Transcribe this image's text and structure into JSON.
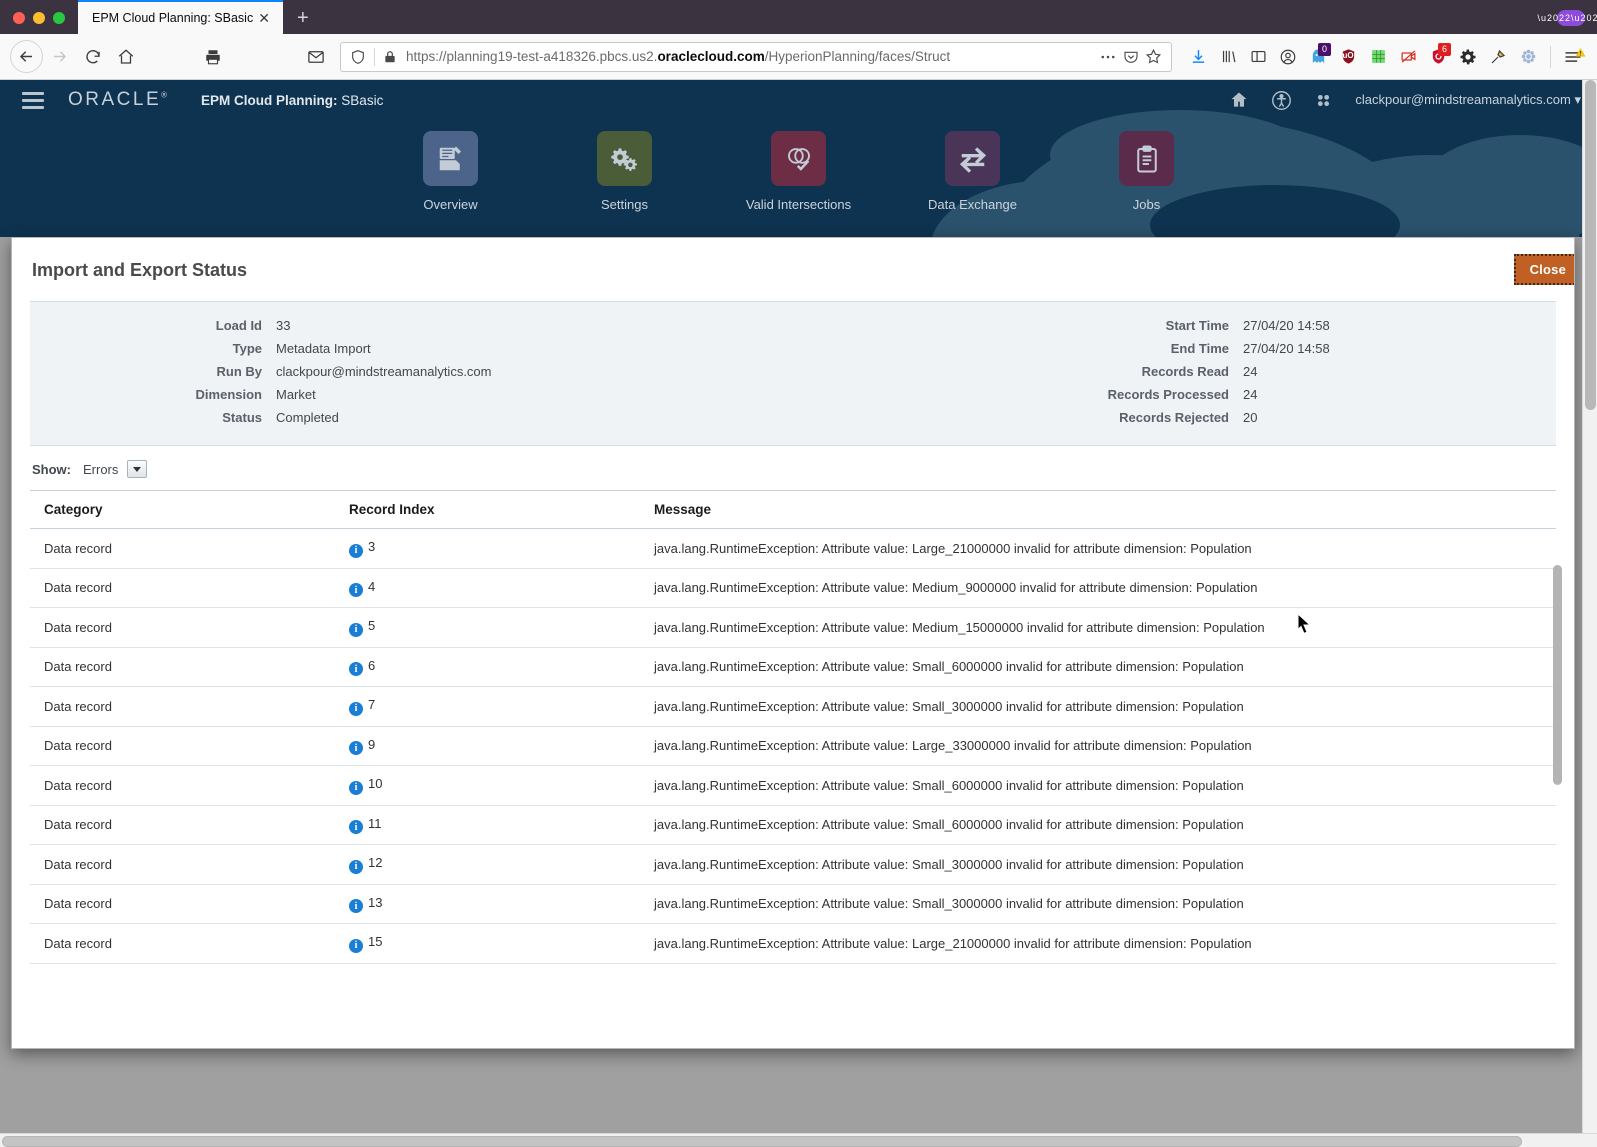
{
  "browser": {
    "tab": {
      "title": "EPM Cloud Planning: SBasic",
      "close_label": "✕"
    },
    "new_tab_label": "+",
    "nav": {
      "back_icon": "back-arrow-icon",
      "forward_icon": "forward-arrow-icon",
      "reload_icon": "reload-icon",
      "home_icon": "home-icon",
      "print_icon": "print-icon",
      "mail_icon": "mail-icon"
    },
    "url": {
      "protocol": "https://",
      "subdomain": "planning19-test-a418326.pbcs.us2.",
      "domain": "oraclecloud.com",
      "path": "/HyperionPlanning/faces/Struct",
      "full": "https://planning19-test-a418326.pbcs.us2.oraclecloud.com/HyperionPlanning/faces/Struct",
      "shield_icon": "shield-icon",
      "lock_icon": "lock-icon",
      "more_icon": "ellipsis-icon",
      "pocket_icon": "pocket-icon",
      "bookmark_icon": "star-icon"
    },
    "extensions": [
      {
        "name": "downloads-icon",
        "badge": ""
      },
      {
        "name": "library-icon",
        "badge": ""
      },
      {
        "name": "sidebar-icon",
        "badge": ""
      },
      {
        "name": "account-icon",
        "badge": ""
      },
      {
        "name": "ghostery-icon",
        "badge": "0"
      },
      {
        "name": "ublock-origin-icon",
        "badge": ""
      },
      {
        "name": "green-grid-icon",
        "badge": ""
      },
      {
        "name": "disabled-video-icon",
        "badge": ""
      },
      {
        "name": "adblock-icon",
        "badge": "6"
      },
      {
        "name": "gear-dark-icon",
        "badge": ""
      },
      {
        "name": "tools-icon",
        "badge": ""
      },
      {
        "name": "settings-flower-icon",
        "badge": ""
      }
    ],
    "app_menu_icon": "hamburger-menu-icon"
  },
  "epm": {
    "logo": "ORACLE",
    "logo_trademark": "®",
    "app_title_bold": "EPM Cloud Planning:",
    "app_title_rest": " SBasic",
    "user_email": "clackpour@mindstreamanalytics.com",
    "header_icons": [
      {
        "name": "home-icon"
      },
      {
        "name": "accessibility-icon"
      },
      {
        "name": "app-grid-icon"
      }
    ],
    "nav_cards": [
      {
        "label": "Overview",
        "icon": "overview-icon",
        "color": "#4c648a"
      },
      {
        "label": "Settings",
        "icon": "settings-gears-icon",
        "color": "#4a5c38"
      },
      {
        "label": "Valid Intersections",
        "icon": "valid-intersections-icon",
        "color": "#6d2e45"
      },
      {
        "label": "Data Exchange",
        "icon": "data-exchange-icon",
        "color": "#4a3559"
      },
      {
        "label": "Jobs",
        "icon": "jobs-clipboard-icon",
        "color": "#5b2b4c"
      }
    ]
  },
  "dialog": {
    "title": "Import and Export Status",
    "close_label": "Close",
    "summary_left": [
      {
        "label": "Load Id",
        "value": "33"
      },
      {
        "label": "Type",
        "value": "Metadata Import"
      },
      {
        "label": "Run By",
        "value": "clackpour@mindstreamanalytics.com"
      },
      {
        "label": "Dimension",
        "value": "Market"
      },
      {
        "label": "Status",
        "value": "Completed"
      }
    ],
    "summary_right": [
      {
        "label": "Start Time",
        "value": "27/04/20 14:58"
      },
      {
        "label": "End Time",
        "value": "27/04/20 14:58"
      },
      {
        "label": "Records Read",
        "value": "24"
      },
      {
        "label": "Records Processed",
        "value": "24"
      },
      {
        "label": "Records Rejected",
        "value": "20"
      }
    ],
    "show": {
      "label": "Show:",
      "value": "Errors",
      "dropdown_icon": "chevron-down-icon"
    },
    "table": {
      "columns": [
        "Category",
        "Record Index",
        "Message"
      ],
      "rows": [
        {
          "category": "Data record",
          "index": "3",
          "message": "java.lang.RuntimeException: Attribute value: Large_21000000 invalid for attribute dimension: Population"
        },
        {
          "category": "Data record",
          "index": "4",
          "message": "java.lang.RuntimeException: Attribute value: Medium_9000000 invalid for attribute dimension: Population"
        },
        {
          "category": "Data record",
          "index": "5",
          "message": "java.lang.RuntimeException: Attribute value: Medium_15000000 invalid for attribute dimension: Population"
        },
        {
          "category": "Data record",
          "index": "6",
          "message": "java.lang.RuntimeException: Attribute value: Small_6000000 invalid for attribute dimension: Population"
        },
        {
          "category": "Data record",
          "index": "7",
          "message": "java.lang.RuntimeException: Attribute value: Small_3000000 invalid for attribute dimension: Population"
        },
        {
          "category": "Data record",
          "index": "9",
          "message": "java.lang.RuntimeException: Attribute value: Large_33000000 invalid for attribute dimension: Population"
        },
        {
          "category": "Data record",
          "index": "10",
          "message": "java.lang.RuntimeException: Attribute value: Small_6000000 invalid for attribute dimension: Population"
        },
        {
          "category": "Data record",
          "index": "11",
          "message": "java.lang.RuntimeException: Attribute value: Small_6000000 invalid for attribute dimension: Population"
        },
        {
          "category": "Data record",
          "index": "12",
          "message": "java.lang.RuntimeException: Attribute value: Small_3000000 invalid for attribute dimension: Population"
        },
        {
          "category": "Data record",
          "index": "13",
          "message": "java.lang.RuntimeException: Attribute value: Small_3000000 invalid for attribute dimension: Population"
        },
        {
          "category": "Data record",
          "index": "15",
          "message": "java.lang.RuntimeException: Attribute value: Large_21000000 invalid for attribute dimension: Population"
        }
      ],
      "row_info_icon": "info-icon"
    }
  }
}
